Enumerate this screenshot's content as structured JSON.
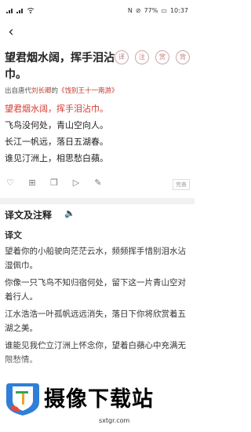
{
  "status": {
    "left_icons": [
      "sim-signal",
      "wifi"
    ],
    "battery": "77%",
    "time": "10:37"
  },
  "poem": {
    "title": "望君烟水阔，挥手泪沾巾。",
    "tags": [
      "译",
      "注",
      "赏",
      "背"
    ],
    "source_prefix": "出自唐代",
    "author": "刘长卿",
    "source_mid": "的",
    "book": "《饯别王十一南游》",
    "lines": [
      {
        "text": "望君烟水阔，挥手泪沾巾。",
        "highlight": true
      },
      {
        "text": "飞鸟没何处，青山空向人。",
        "highlight": false
      },
      {
        "text": "长江一帆远，落日五湖春。",
        "highlight": false
      },
      {
        "text": "谁见汀洲上，相思愁白蘋。",
        "highlight": false
      }
    ],
    "expand_label": "完善"
  },
  "translation": {
    "section_title": "译文及注释",
    "sub_title": "译文",
    "paragraphs": [
      "望着你的小船驶向茫茫云水，频频挥手惜别泪水沾湿佩巾。",
      "你像一只飞鸟不知归宿何处，留下这一片青山空对着行人。",
      "江水浩浩一叶孤帆远远消失，落日下你将欣赏着五湖之美。",
      "谁能见我伫立汀洲上怀念你，望着白蘋心中充满无限愁情。"
    ]
  },
  "watermark": {
    "brand": "摄像下载站",
    "domain": "sxtgr.com"
  }
}
